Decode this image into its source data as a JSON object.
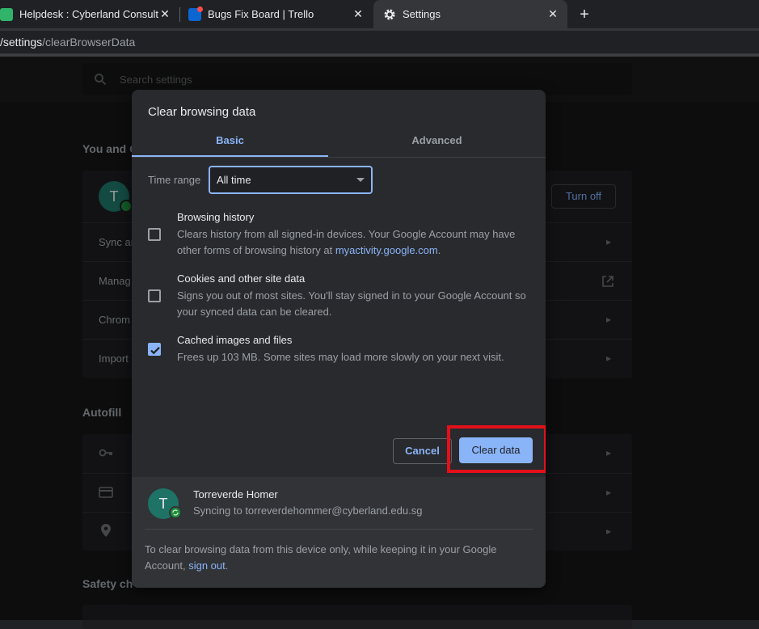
{
  "browser": {
    "tabs": [
      {
        "label": "Helpdesk : Cyberland Consultanc"
      },
      {
        "label": "Bugs Fix Board | Trello"
      },
      {
        "label": "Settings"
      }
    ],
    "close_glyph": "✕",
    "new_tab_glyph": "+",
    "url_path_strong": "/settings",
    "url_path_rest": "/clearBrowserData"
  },
  "settings": {
    "search_placeholder": "Search settings",
    "section_you": "You and G",
    "avatar_initial": "T",
    "turn_off": "Turn off",
    "rows_you": [
      "Sync ar",
      "Manag",
      "Chrom",
      "Import"
    ],
    "section_autofill": "Autofill",
    "section_safety": "Safety ch"
  },
  "dialog": {
    "title": "Clear browsing data",
    "tab_basic": "Basic",
    "tab_advanced": "Advanced",
    "time_range_label": "Time range",
    "time_range_value": "All time",
    "options": [
      {
        "title": "Browsing history",
        "desc": "Clears history from all signed-in devices. Your Google Account may have other forms of browsing history at ",
        "link": "myactivity.google.com",
        "desc_end": ".",
        "checked": false
      },
      {
        "title": "Cookies and other site data",
        "desc": "Signs you out of most sites. You'll stay signed in to your Google Account so your synced data can be cleared.",
        "checked": false
      },
      {
        "title": "Cached images and files",
        "desc": "Frees up 103 MB. Some sites may load more slowly on your next visit.",
        "checked": true
      }
    ],
    "cancel_label": "Cancel",
    "clear_label": "Clear data",
    "account": {
      "initial": "T",
      "name": "Torreverde Homer",
      "sync_text": "Syncing to torreverdehommer@cyberland.edu.sg"
    },
    "footer_note": "To clear browsing data from this device only, while keeping it in your Google Account, ",
    "footer_link": "sign out",
    "footer_end": "."
  },
  "colors": {
    "accent": "#8ab4f8",
    "highlight_frame": "#e3101a",
    "avatar": "#1e7266"
  }
}
